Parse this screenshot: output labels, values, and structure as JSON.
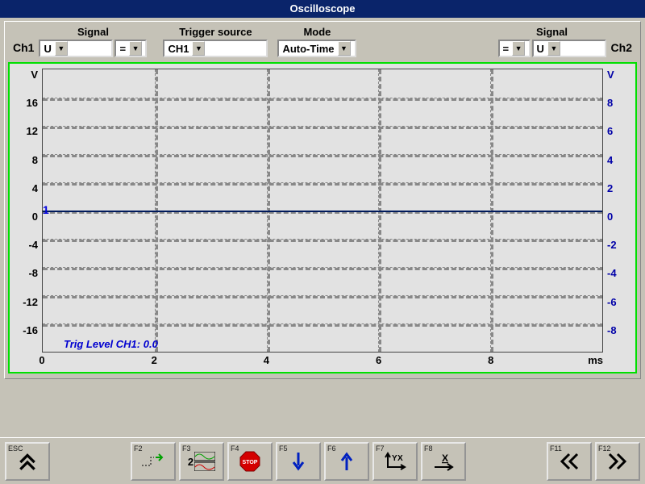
{
  "title": "Oscilloscope",
  "channels": {
    "ch1_label": "Ch1",
    "ch2_label": "Ch2"
  },
  "controls": {
    "signal_label": "Signal",
    "trigger_label": "Trigger source",
    "mode_label": "Mode",
    "ch1_signal": "U",
    "ch1_op": "=",
    "trigger_source": "CH1",
    "mode": "Auto-Time",
    "ch2_op": "=",
    "ch2_signal": "U"
  },
  "scope": {
    "left_unit": "V",
    "right_unit": "V",
    "x_unit": "ms",
    "left_ticks": [
      "V",
      "16",
      "12",
      "8",
      "4",
      "0",
      "-4",
      "-8",
      "-12",
      "-16",
      ""
    ],
    "right_ticks": [
      "V",
      "8",
      "6",
      "4",
      "2",
      "0",
      "-2",
      "-4",
      "-6",
      "-8",
      ""
    ],
    "x_ticks": [
      "0",
      "2",
      "4",
      "6",
      "8"
    ],
    "trace_marker": "1",
    "trig_text": "Trig Level CH1:  0.0"
  },
  "chart_data": {
    "type": "line",
    "title": "Oscilloscope Trace",
    "xlabel": "ms",
    "ylabel_left": "V (Ch1)",
    "ylabel_right": "V (Ch2)",
    "xlim": [
      0,
      10
    ],
    "ylim_left": [
      -16,
      16
    ],
    "ylim_right": [
      -8,
      8
    ],
    "series": [
      {
        "name": "Ch1",
        "axis": "left",
        "x": [
          0,
          10
        ],
        "values": [
          0,
          0
        ]
      }
    ],
    "trigger_level_ch1": 0.0
  },
  "fkeys": {
    "esc": "ESC",
    "f2": "F2",
    "f3": "F3",
    "f4": "F4",
    "f5": "F5",
    "f6": "F6",
    "f7": "F7",
    "f8": "F8",
    "f11": "F11",
    "f12": "F12",
    "stop_label": "STOP",
    "two_label": "2"
  }
}
